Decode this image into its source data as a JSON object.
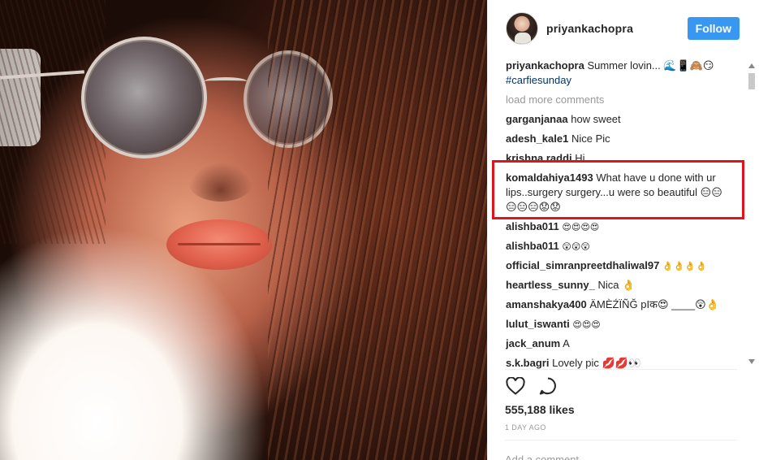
{
  "post": {
    "username": "priyankachopra",
    "follow_label": "Follow",
    "likes": "555,188 likes",
    "date": "1 DAY AGO",
    "add_comment_placeholder": "Add a comment..."
  },
  "caption": {
    "user": "priyankachopra",
    "text": "Summer lovin... 🌊📱🙈😏",
    "hashtag": "#carfiesunday"
  },
  "load_more": "load more comments",
  "comments": [
    {
      "user": "garganjanaa",
      "text": "how sweet"
    },
    {
      "user": "adesh_kale1",
      "text": "Nice Pic"
    },
    {
      "user": "krishna.raddi",
      "text": "Hi"
    },
    {
      "user": "komaldahiya1493",
      "text": "What have u done with ur lips..surgery surgery...u were so beautiful 😑😑😑😑😑😟😟"
    },
    {
      "user": "alishba011",
      "text": "😍😍😍😍"
    },
    {
      "user": "alishba011",
      "text": "😲😲😲"
    },
    {
      "user": "official_simranpreetdhaliwal97",
      "text": "👌👌👌👌"
    },
    {
      "user": "heartless_sunny_",
      "text": "Nica 👌"
    },
    {
      "user": "amanshakya400",
      "text": "ÄMÈŹÏÑĞ pIक😍 ____😲👌"
    },
    {
      "user": "lulut_iswanti",
      "text": "😍😍😍"
    },
    {
      "user": "jack_anum",
      "text": "A"
    },
    {
      "user": "s.k.bagri",
      "text": "Lovely pic 💋💋👀"
    }
  ],
  "icons": {
    "like": "heart-icon",
    "comment": "comment-icon"
  },
  "colors": {
    "follow_button": "#3897f0",
    "highlight_border": "#e2141b",
    "hashtag": "#003569"
  }
}
